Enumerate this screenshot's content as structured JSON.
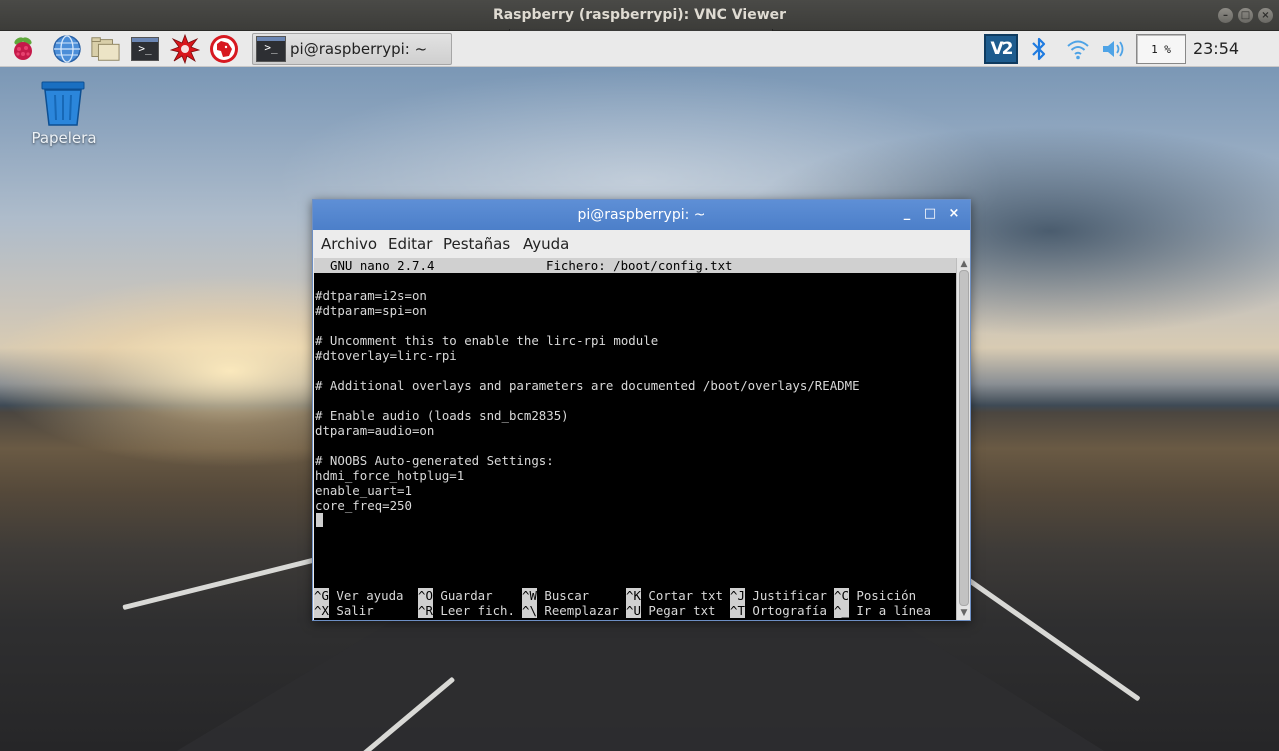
{
  "vnc": {
    "title": "Raspberry (raspberrypi): VNC Viewer"
  },
  "panel": {
    "launchers": [
      "raspberry-menu-icon",
      "web-browser-icon",
      "file-manager-icon",
      "terminal-icon",
      "mathematica-icon",
      "wolfram-icon"
    ],
    "taskbar_item": "pi@raspberrypi: ~",
    "tray": {
      "vnc_label": "V2",
      "icons": [
        "vnc-icon",
        "bluetooth-icon",
        "wifi-icon",
        "volume-icon"
      ],
      "cpu": "1 %",
      "clock": "23:54"
    },
    "terminal_glyph": ">_"
  },
  "desktop": {
    "trash_label": "Papelera"
  },
  "terminal": {
    "title": "pi@raspberrypi: ~",
    "menu": [
      "Archivo",
      "Editar",
      "Pestañas",
      "Ayuda"
    ],
    "nano": {
      "version": "GNU nano 2.7.4",
      "file": "Fichero: /boot/config.txt",
      "lines": [
        "#dtparam=i2s=on",
        "#dtparam=spi=on",
        "",
        "# Uncomment this to enable the lirc-rpi module",
        "#dtoverlay=lirc-rpi",
        "",
        "# Additional overlays and parameters are documented /boot/overlays/README",
        "",
        "# Enable audio (loads snd_bcm2835)",
        "dtparam=audio=on",
        "",
        "# NOOBS Auto-generated Settings:",
        "hdmi_force_hotplug=1",
        "enable_uart=1",
        "core_freq=250"
      ],
      "shortcuts": [
        {
          "key": "^G",
          "label": " Ver ayuda"
        },
        {
          "key": "^O",
          "label": " Guardar"
        },
        {
          "key": "^W",
          "label": " Buscar"
        },
        {
          "key": "^K",
          "label": " Cortar txt"
        },
        {
          "key": "^J",
          "label": " Justificar"
        },
        {
          "key": "^C",
          "label": " Posición"
        },
        {
          "key": "^X",
          "label": " Salir"
        },
        {
          "key": "^R",
          "label": " Leer fich."
        },
        {
          "key": "^\\",
          "label": " Reemplazar"
        },
        {
          "key": "^U",
          "label": " Pegar txt"
        },
        {
          "key": "^T",
          "label": " Ortografía"
        },
        {
          "key": "^_",
          "label": " Ir a línea"
        }
      ]
    }
  },
  "colors": {
    "terminal_titlebar": "#5283cf",
    "panel": "#eaeaea",
    "terminal_bg": "#000000",
    "nano_bar": "#d0d0d0"
  }
}
